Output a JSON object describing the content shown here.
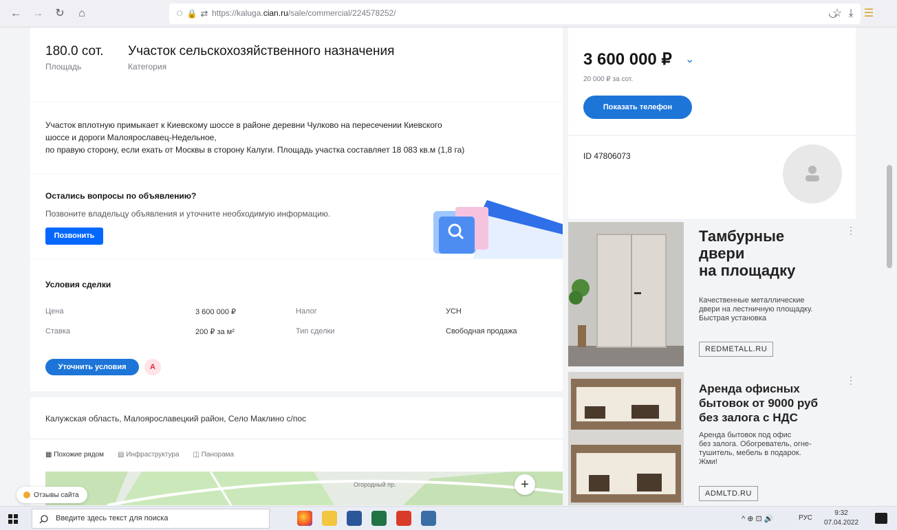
{
  "browser": {
    "url_prefix": "https://kaluga.",
    "url_domain": "cian.ru",
    "url_path": "/sale/commercial/224578252/",
    "back_label": "←",
    "forward_label": "→",
    "reload_label": "↻",
    "home_label": "⌂",
    "shield_label": "◌",
    "lock_label": "🔒",
    "perm_label": "⇄",
    "star_label": "☆",
    "pocket_label": "◡",
    "download_label": "⤓",
    "ext_label": "☰"
  },
  "listing": {
    "area_value": "180.0 сот.",
    "area_label": "Площадь",
    "category_value": "Участок сельскохозяйственного назначения",
    "category_label": "Категория",
    "description": [
      "Участок вплотную примыкает к Киевскому шоссе в районе деревни Чулково на пересечении Киевского",
      "шоссе и дороги Малоярославец-Недельное,",
      "по правую сторону, если ехать от Москвы в сторону Калуги. Площадь участка составляет 18 083 кв.м (1,8 га)"
    ]
  },
  "questions": {
    "title": "Остались вопросы по объявлению?",
    "text": "Позвоните владельцу объявления и уточните необходимую информацию.",
    "call_button": "Позвонить"
  },
  "deal": {
    "title": "Условия сделки",
    "price_label": "Цена",
    "price_value": "3 600 000 ₽",
    "tax_label": "Налог",
    "tax_value": "УСН",
    "rate_label": "Ставка",
    "rate_value": "200 ₽ за м²",
    "deal_type_label": "Тип сделки",
    "deal_type_value": "Свободная продажа",
    "clarify_button": "Уточнить условия",
    "warning_icon_label": "A"
  },
  "location": {
    "address": "Калужская область, Малоярославецкий район, Село Маклино с/пос",
    "tabs": [
      {
        "icon": "▦",
        "label": "Похожие рядом"
      },
      {
        "icon": "▤",
        "label": "Инфраструктура"
      },
      {
        "icon": "◫",
        "label": "Панорама"
      }
    ],
    "map_label": "Отзывы сайта",
    "map_road_label": "Огородный пр.",
    "zoom_in": "+"
  },
  "sidebar": {
    "price": "3 600 000 ₽",
    "price_per_unit": "20 000 ₽ за сот.",
    "show_phone_button": "Показать телефон",
    "listing_id": "ID 47806073",
    "dropdown_icon": "⌄"
  },
  "ads": [
    {
      "title": "Тамбурные двери на площадку",
      "title_lines": [
        "Тамбурные",
        "двери",
        "на площадку"
      ],
      "description_lines": [
        "Качественные металлические",
        "двери на лестничную площадку.",
        "Быстрая установка"
      ],
      "url": "REDMETALL.RU",
      "more": "⋮"
    },
    {
      "title": "Аренда офисных бытовок от 9000 руб без залога с НДС",
      "title_lines": [
        "Аренда офисных",
        "бытовок от 9000 руб",
        "без залога с НДС"
      ],
      "description_lines": [
        "Аренда бытовок под офис",
        "без залога. Обогреватель, огне-",
        "тушитель, мебель в подарок.",
        "Жми!"
      ],
      "url": "ADMLTD.RU",
      "more": "⋮"
    }
  ],
  "taskbar": {
    "search_placeholder": "Введите здесь текст для поиска",
    "tray_icons": "^  ⊕  ⊡  🔊",
    "language": "РУС",
    "time": "9:32",
    "date": "07.04.2022"
  },
  "colors": {
    "accent": "#0468ff",
    "button_blue": "#1d75d8",
    "page_bg": "#f3f4f6"
  }
}
